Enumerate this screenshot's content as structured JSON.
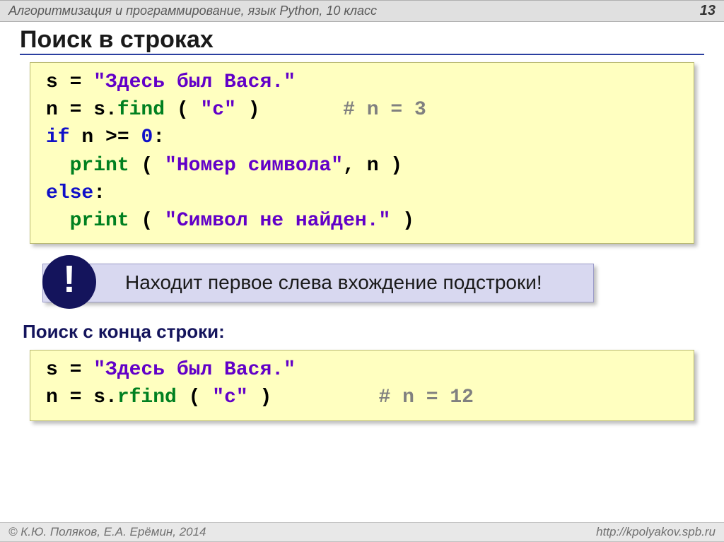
{
  "header": {
    "subject": "Алгоритмизация и программирование, язык Python, 10 класс",
    "page_number": "13"
  },
  "title": "Поиск в строках",
  "code1": {
    "l1_a": "s = ",
    "l1_b": "\"Здесь был Вася.\"",
    "l2_a": "n = s.",
    "l2_fn": "find",
    "l2_b": " ( ",
    "l2_str": "\"с\"",
    "l2_c": " )       ",
    "l2_cmt": "# n = 3",
    "l3_a": "if",
    "l3_b": " n >= ",
    "l3_c": "0",
    "l3_d": ":",
    "l4_pad": "  ",
    "l4_fn": "print",
    "l4_a": " ( ",
    "l4_str": "\"Номер символа\"",
    "l4_b": ", n )",
    "l5_a": "else",
    "l5_b": ":",
    "l6_pad": "  ",
    "l6_fn": "print",
    "l6_a": " ( ",
    "l6_str": "\"Символ не найден.\"",
    "l6_b": " )"
  },
  "callout": {
    "badge": "!",
    "text": "Находит первое слева вхождение подстроки!"
  },
  "subheading": "Поиск с конца строки:",
  "code2": {
    "l1_a": "s = ",
    "l1_b": "\"Здесь был Вася.\"",
    "l2_a": "n = s.",
    "l2_fn": "rfind",
    "l2_b": " ( ",
    "l2_str": "\"с\"",
    "l2_c": " )         ",
    "l2_cmt": "# n = 12"
  },
  "footer": {
    "author": "© К.Ю. Поляков, Е.А. Ерёмин, 2014",
    "url": "http://kpolyakov.spb.ru"
  }
}
